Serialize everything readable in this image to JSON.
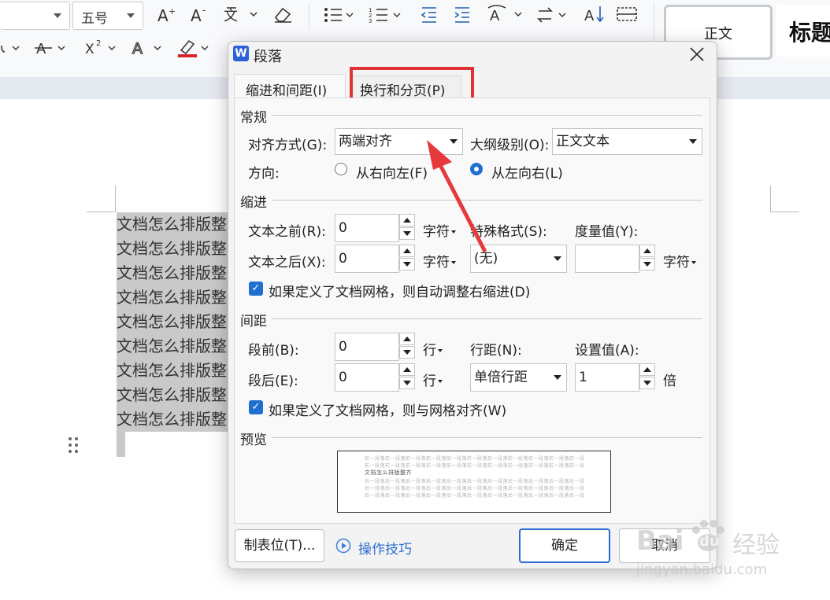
{
  "ribbon": {
    "font_size": "五号",
    "font_grow_icon": "font-grow-icon",
    "font_shrink_icon": "font-shrink-icon",
    "phonetic_icon": "phonetic-guide-icon",
    "eraser_icon": "clear-format-icon",
    "style_normal": "正文",
    "style_heading": "标题"
  },
  "document": {
    "lines": [
      "文档怎么排版整齐",
      "文档怎么排版整齐",
      "文档怎么排版整齐",
      "文档怎么排版整齐",
      "文档怎么排版整齐",
      "文档怎么排版整齐",
      "文档怎么排版整齐",
      "文档怎么排版整齐",
      "文档怎么排版整齐"
    ]
  },
  "dialog": {
    "app_badge": "W",
    "title": "段落",
    "tabs": [
      "缩进和间距(I)",
      "换行和分页(P)"
    ],
    "general": {
      "section": "常规",
      "align_label": "对齐方式(G):",
      "align_value": "两端对齐",
      "outline_label": "大纲级别(O):",
      "outline_value": "正文文本",
      "direction_label": "方向:",
      "rtl_label": "从右向左(F)",
      "ltr_label": "从左向右(L)"
    },
    "indent": {
      "section": "缩进",
      "before_label": "文本之前(R):",
      "before_value": "0",
      "after_label": "文本之后(X):",
      "after_value": "0",
      "unit": "字符",
      "special_label": "特殊格式(S):",
      "special_value": "(无)",
      "measure_label": "度量值(Y):",
      "measure_value": "",
      "measure_unit": "字符",
      "auto_adjust": "如果定义了文档网格，则自动调整右缩进(D)"
    },
    "spacing": {
      "section": "间距",
      "before_label": "段前(B):",
      "before_value": "0",
      "after_label": "段后(E):",
      "after_value": "0",
      "unit": "行",
      "line_label": "行距(N):",
      "line_value": "单倍行距",
      "set_label": "设置值(A):",
      "set_value": "1",
      "set_unit": "倍",
      "snap_grid": "如果定义了文档网格，则与网格对齐(W)"
    },
    "preview": {
      "section": "预览",
      "before_text": "前一段落前一段落前一段落前一段落前一段落前一段落前一段落前一段落前一段落前一段落前一段落前一段落前一段落前一段落",
      "sample_text": "文档怎么排版整齐",
      "after_text": "后一段落后一段落后一段落后一段落后一段落后一段落后一段落后一段落后一段落后一段落后一段落后一段落后一段落后一段落"
    },
    "buttons": {
      "tabs": "制表位(T)...",
      "tips": "操作技巧",
      "ok": "确定",
      "cancel": "取消"
    }
  },
  "watermark": {
    "brand": "Bai",
    "brand2": "du",
    "jingyan": "经验",
    "url": "jingyan.baidu.com"
  },
  "colors": {
    "accent": "#1f6fd1",
    "highlight_red": "#e03236",
    "selection_gray": "#c9c9c9"
  }
}
